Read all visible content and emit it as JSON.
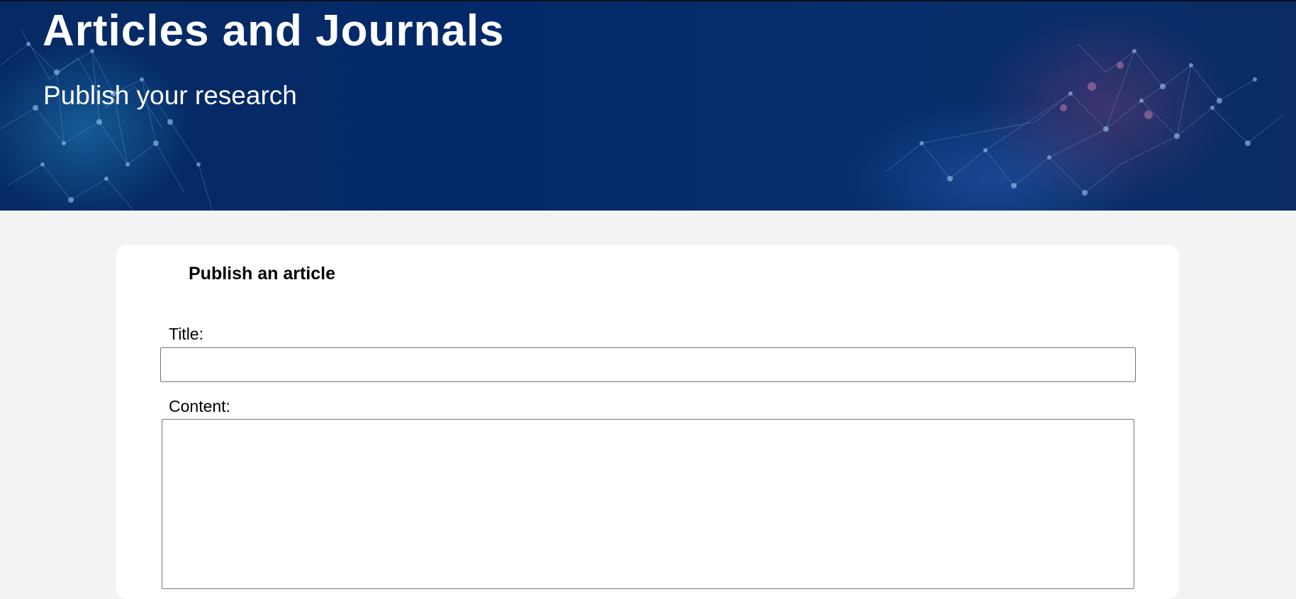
{
  "header": {
    "title": "Articles and Journals",
    "subtitle": "Publish your research",
    "background": "network-pattern-image"
  },
  "form": {
    "heading": "Publish an article",
    "title_label": "Title:",
    "title_value": "",
    "content_label": "Content:",
    "content_value": ""
  },
  "colors": {
    "header_background": "#05296a",
    "page_background": "#f3f3f3",
    "card_background": "#ffffff",
    "input_border": "#767676"
  }
}
